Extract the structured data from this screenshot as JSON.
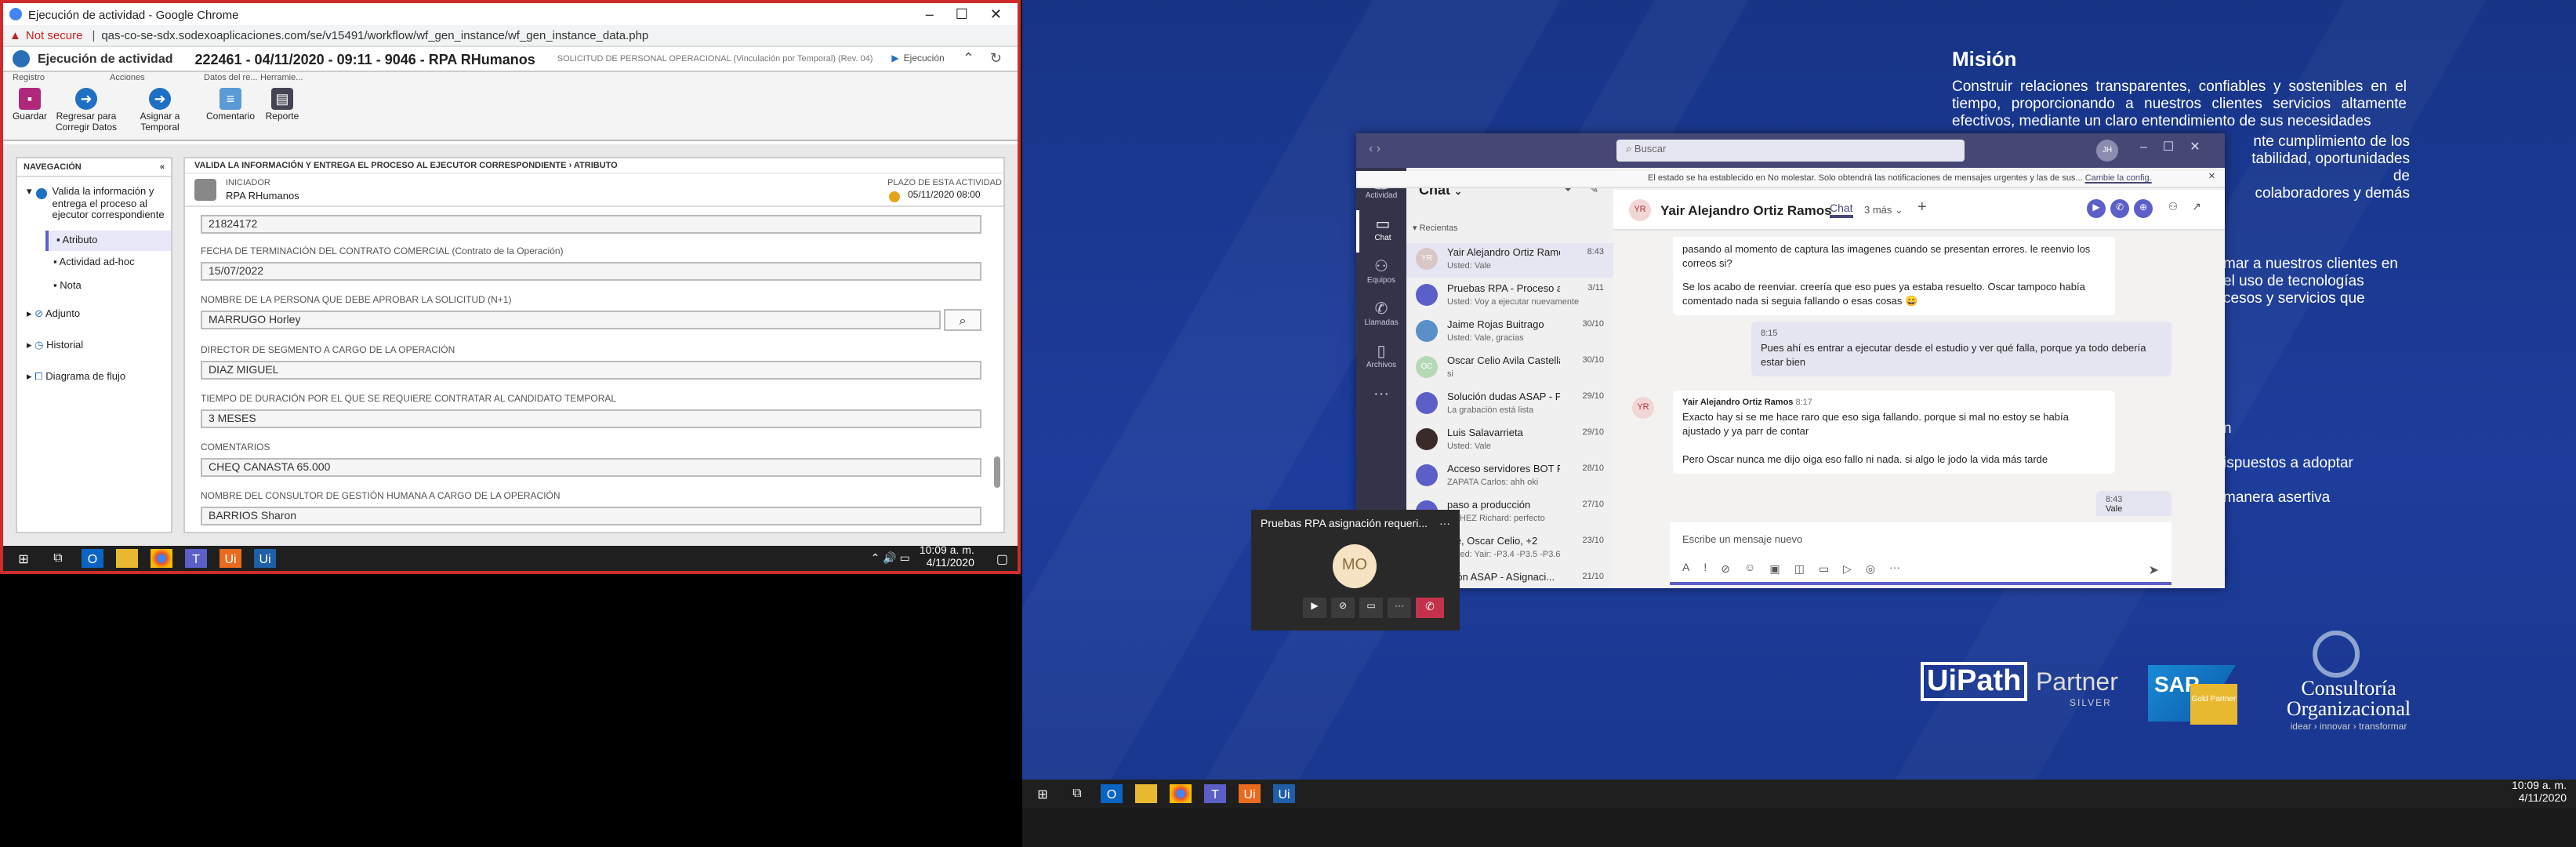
{
  "chrome": {
    "window_title": "Ejecución de actividad - Google Chrome",
    "not_secure": "Not secure",
    "url": "qas-co-se-sdx.sodexoaplicaciones.com/se/v15491/workflow/wf_gen_instance/wf_gen_instance_data.php"
  },
  "app": {
    "module": "Ejecución de actividad",
    "instance_title": "222461 - 04/11/2020 - 09:11 - 9046 - RPA RHumanos",
    "request_type": "SOLICITUD DE PERSONAL OPERACIONAL (Vinculación por Temporal) (Rev. 04)",
    "status": "Ejecución"
  },
  "ribbon": {
    "groups": [
      "Registro",
      "Acciones",
      "Datos del re...",
      "Herramie..."
    ],
    "buttons": [
      "Guardar",
      "Regresar para Corregir Datos",
      "Asignar a Temporal",
      "Comentario",
      "Reporte"
    ]
  },
  "nav": {
    "title": "NAVEGACIÓN",
    "activity": "Valida la información y entrega el proceso al ejecutor correspondiente",
    "sub_items": [
      "Atributo",
      "Actividad ad-hoc",
      "Nota"
    ],
    "sections": [
      "Adjunto",
      "Historial",
      "Diagrama de flujo"
    ]
  },
  "form": {
    "breadcrumb_activity": "VALIDA LA INFORMACIÓN Y ENTREGA EL PROCESO AL EJECUTOR CORRESPONDIENTE",
    "breadcrumb_sep": "›",
    "breadcrumb_attr": "ATRIBUTO",
    "initiator_label": "INICIADOR",
    "initiator_value": "RPA RHumanos",
    "deadline_label": "PLAZO DE ESTA ACTIVIDAD",
    "deadline_value": "05/11/2020 08:00",
    "fields": [
      {
        "label": "",
        "value": "21824172"
      },
      {
        "label": "FECHA DE TERMINACIÓN DEL CONTRATO COMERCIAL (Contrato de la Operación)",
        "value": "15/07/2022"
      },
      {
        "label": "NOMBRE DE LA PERSONA QUE DEBE APROBAR LA SOLICITUD (N+1)",
        "value": "MARRUGO Horley"
      },
      {
        "label": "DIRECTOR DE SEGMENTO A CARGO DE LA OPERACIÓN",
        "value": "DIAZ MIGUEL"
      },
      {
        "label": "TIEMPO DE DURACIÓN POR EL QUE SE REQUIERE CONTRATAR AL CANDIDATO TEMPORAL",
        "value": "3 MESES"
      },
      {
        "label": "COMENTARIOS",
        "value": "CHEQ CANASTA 65.000"
      },
      {
        "label": "NOMBRE DEL CONSULTOR DE GESTIÓN HUMANA A CARGO DE LA OPERACIÓN",
        "value": "BARRIOS Sharon"
      }
    ]
  },
  "taskbar_left": {
    "time": "10:09 a. m.",
    "date": "4/11/2020"
  },
  "taskbar_right": {
    "time": "10:09 a. m.",
    "date": "4/11/2020"
  },
  "desktop": {
    "mision_title": "Misión",
    "mision_text": "Construir relaciones transparentes, confiables y sostenibles en el tiempo, proporcionando a nuestros clientes servicios altamente efectivos, mediante un claro entendimiento de sus necesidades",
    "mision_cont1": "nte cumplimiento de los",
    "mision_cont2": "tabilidad, oportunidades de",
    "mision_cont3": "colaboradores y demás",
    "vision_cont1": "mar a nuestros clientes en",
    "vision_cont2": "el uso de tecnologías",
    "vision_cont3": "cesos y servicios que",
    "val1": "n",
    "val2": "ispuestos a adoptar",
    "val3": "manera asertiva",
    "logo_uipath": "UiPath",
    "logo_partner": "Partner",
    "logo_silver": "SILVER",
    "logo_sap": "SAP",
    "logo_gold": "Gold Partner",
    "logo_consultoria": "Consultoría",
    "logo_organizacional": "Organizacional",
    "logo_tagline": "idear › innovar › transformar"
  },
  "teams": {
    "search_placeholder": "Buscar",
    "avatar_initials": "JH",
    "dnd_banner": "El estado se ha establecido en No molestar. Solo obtendrá las notificaciones de mensajes urgentes y las de sus...",
    "dnd_link": "Cambie la config.",
    "rail": [
      "Actividad",
      "Chat",
      "Equipos",
      "Llamadas",
      "Archivos"
    ],
    "list_title": "Chat",
    "recent_label": "Recientas",
    "chats": [
      {
        "initials": "YR",
        "color": "#d9c7c7",
        "name": "Yair Alejandro Ortiz Ramos",
        "time": "8:43",
        "preview": "Usted: Vale"
      },
      {
        "initials": "",
        "color": "#5b5fc7",
        "name": "Pruebas RPA - Proceso asi...",
        "time": "3/11",
        "preview": "Usted: Voy a ejecutar nuevamente"
      },
      {
        "initials": "",
        "color": "#5b8fc7",
        "name": "Jaime Rojas Buitrago",
        "time": "30/10",
        "preview": "Usted: Vale, gracias"
      },
      {
        "initials": "OC",
        "color": "#b5d8b5",
        "name": "Oscar Celio Avila Castella...",
        "time": "30/10",
        "preview": "si"
      },
      {
        "initials": "",
        "color": "#5b5fc7",
        "name": "Solución dudas ASAP - P...",
        "time": "29/10",
        "preview": "La grabación está lista"
      },
      {
        "initials": "",
        "color": "#3a2a2a",
        "name": "Luis Salavarrieta",
        "time": "29/10",
        "preview": "Usted: Vale"
      },
      {
        "initials": "",
        "color": "#5b5fc7",
        "name": "Acceso servidores BOT Fa...",
        "time": "28/10",
        "preview": "ZAPATA Carlos: ahh oki"
      },
      {
        "initials": "",
        "color": "#5b5fc7",
        "name": "paso a producción",
        "time": "27/10",
        "preview": "NCHEZ Richard: perfecto"
      },
      {
        "initials": "",
        "color": "#5b5fc7",
        "name": "me, Oscar Celio, +2",
        "time": "23/10",
        "preview": "Usted: Yair: -P3.4 -P3.5 -P3.6"
      },
      {
        "initials": "",
        "color": "#5b5fc7",
        "name": "isión ASAP - ASignaci...",
        "time": "21/10",
        "preview": ""
      }
    ],
    "header_initials": "YR",
    "header_name": "Yair Alejandro Ortiz Ramos",
    "header_tab": "Chat",
    "header_more": "3 más",
    "msg1": "pasando al momento de captura las imagenes cuando se presentan errores. le reenvio los correos si?",
    "msg2": "Se los acabo de reenviar. creería que eso pues ya estaba resuelto. Oscar tampoco había comentado nada si seguia fallando o esas cosas 😄",
    "me_time": "8:15",
    "me_msg": "Pues ahí es entrar a ejecutar desde el estudio y ver qué falla, porque ya todo debería estar bien",
    "reply_initials": "YR",
    "reply_name": "Yair Alejandro Ortiz Ramos",
    "reply_time": "8:17",
    "reply1": "Exacto hay si se me hace raro que eso siga fallando. porque si mal no estoy se había ajustado y ya parr de contar",
    "reply2": "Pero Oscar nunca me dijo oiga eso fallo ni nada. si algo le jodo la vida más tarde",
    "last_time": "8:43",
    "last_msg": "Vale",
    "compose_placeholder": "Escribe un mensaje nuevo"
  },
  "call": {
    "title": "Pruebas RPA asignación requeri...",
    "initials": "MO"
  }
}
